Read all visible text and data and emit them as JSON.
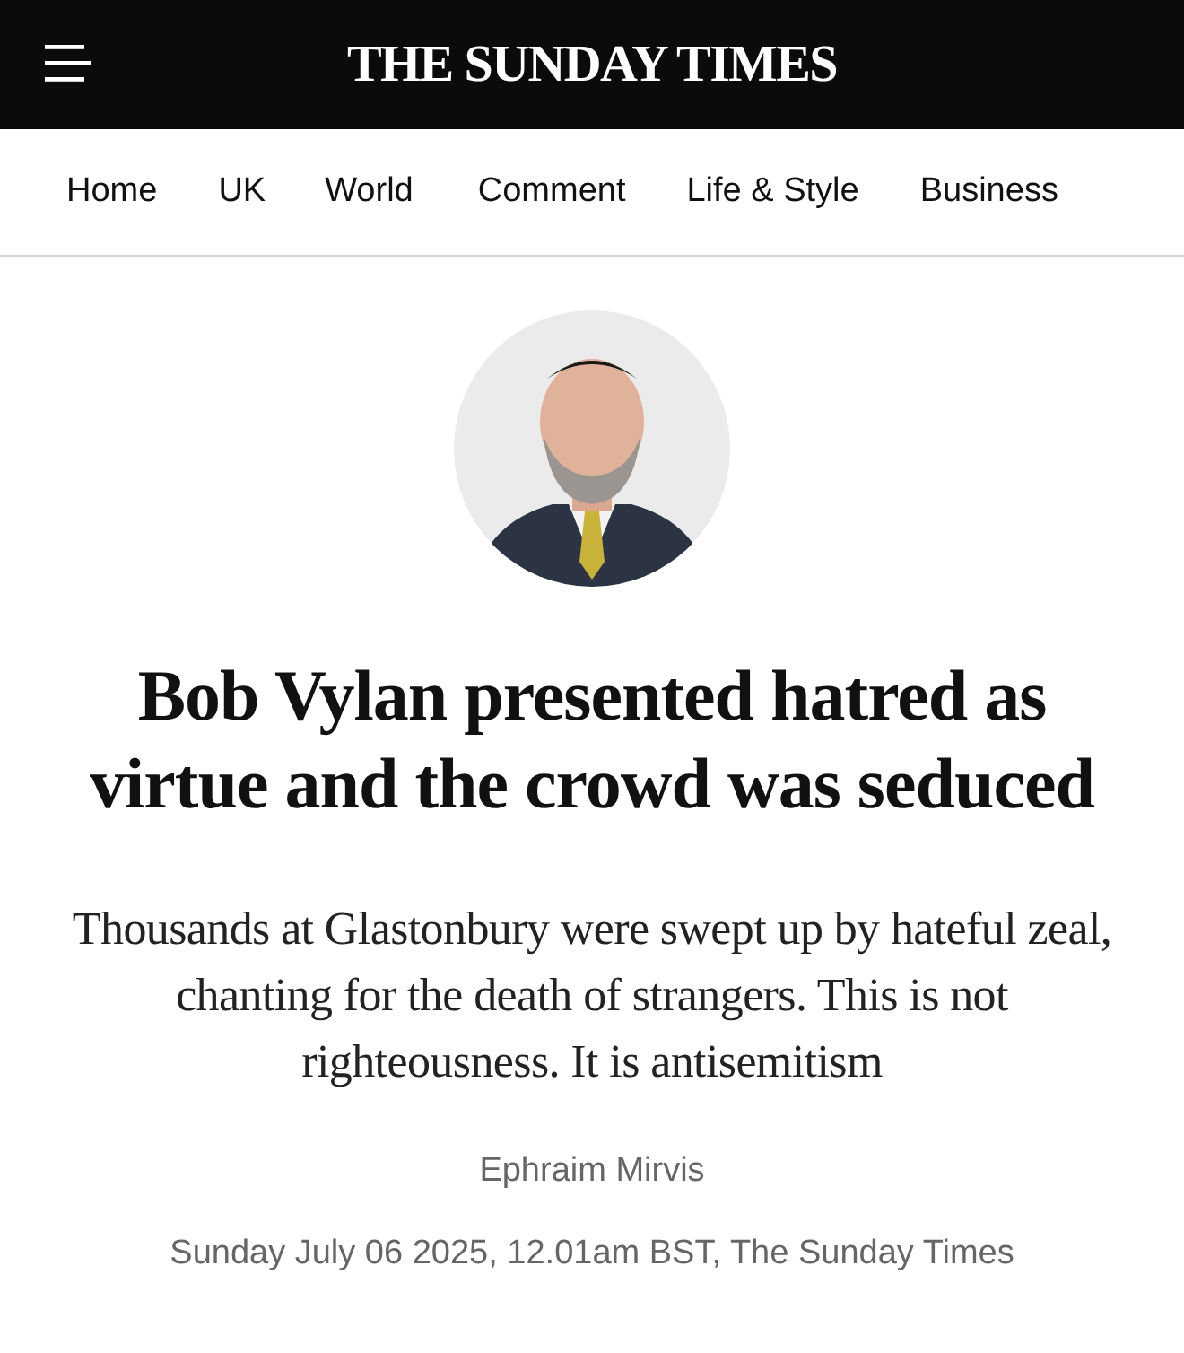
{
  "header": {
    "title": "THE SUNDAY TIMES"
  },
  "nav": {
    "items": [
      {
        "label": "Home"
      },
      {
        "label": "UK"
      },
      {
        "label": "World"
      },
      {
        "label": "Comment"
      },
      {
        "label": "Life & Style"
      },
      {
        "label": "Business"
      }
    ]
  },
  "article": {
    "headline": "Bob Vylan presented hatred as virtue and the crowd was seduced",
    "standfirst": "Thousands at Glastonbury were swept up by hateful zeal, chanting for the death of strangers. This is not righteousness. It is antisemitism",
    "author": "Ephraim Mirvis",
    "dateline": "Sunday July 06 2025, 12.01am BST, The Sunday Times"
  }
}
